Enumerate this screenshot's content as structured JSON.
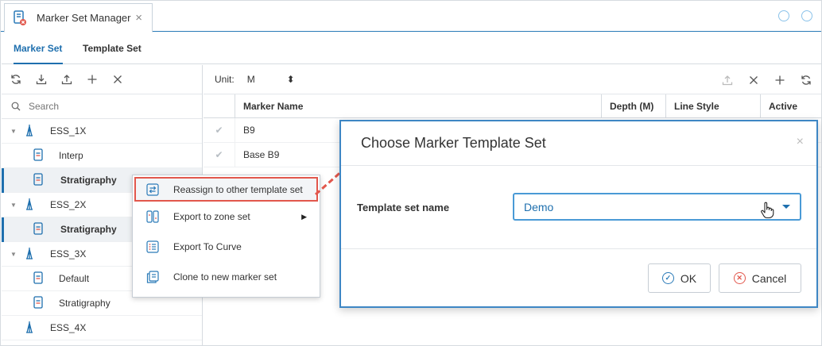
{
  "window": {
    "tab_title": "Marker Set Manager",
    "tab_close": "×"
  },
  "subtabs": [
    {
      "label": "Marker Set",
      "active": true
    },
    {
      "label": "Template Set",
      "active": false
    }
  ],
  "left": {
    "search_placeholder": "Search",
    "tree": [
      {
        "label": "ESS_1X",
        "type": "well",
        "expanded": true
      },
      {
        "label": "Interp",
        "type": "set"
      },
      {
        "label": "Stratigraphy",
        "type": "set",
        "selected": true,
        "bold": true
      },
      {
        "label": "ESS_2X",
        "type": "well",
        "expanded": true
      },
      {
        "label": "Stratigraphy",
        "type": "set",
        "selected": true,
        "bold": true
      },
      {
        "label": "ESS_3X",
        "type": "well",
        "expanded": true
      },
      {
        "label": "Default",
        "type": "set"
      },
      {
        "label": "Stratigraphy",
        "type": "set"
      },
      {
        "label": "ESS_4X",
        "type": "well"
      }
    ]
  },
  "right": {
    "unit_label": "Unit:",
    "unit_value": "M",
    "unit_caret": "⬍",
    "columns": [
      "Marker Name",
      "Depth (M)",
      "Line Style",
      "Active"
    ],
    "rows": [
      {
        "name": "B9"
      },
      {
        "name": "Base B9"
      }
    ]
  },
  "context_menu": {
    "items": [
      {
        "label": "Reassign to other template set",
        "highlighted": true
      },
      {
        "label": "Export to zone set",
        "submenu": true
      },
      {
        "label": "Export To Curve"
      },
      {
        "label": "Clone to new marker set"
      }
    ],
    "submenu_glyph": "▶"
  },
  "dialog": {
    "title": "Choose Marker Template Set",
    "close": "×",
    "field_label": "Template set name",
    "field_value": "Demo",
    "ok_label": "OK",
    "cancel_label": "Cancel"
  },
  "colors": {
    "accent": "#1e6fae",
    "highlight_border": "#e2574c",
    "dialog_border": "#3e86c4"
  }
}
